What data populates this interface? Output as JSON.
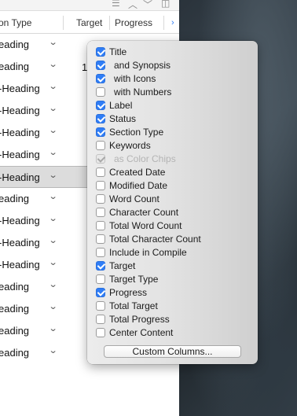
{
  "header": {
    "col_section_type": "on Type",
    "col_target": "Target",
    "col_progress": "Progress",
    "target_first_value_partial": "1"
  },
  "rows": [
    {
      "label": "eading"
    },
    {
      "label": "eading"
    },
    {
      "label": "-Heading"
    },
    {
      "label": "-Heading"
    },
    {
      "label": "-Heading"
    },
    {
      "label": "-Heading"
    },
    {
      "label": "-Heading"
    },
    {
      "label": "eading"
    },
    {
      "label": "-Heading"
    },
    {
      "label": "-Heading"
    },
    {
      "label": "-Heading"
    },
    {
      "label": "eading"
    },
    {
      "label": "eading"
    },
    {
      "label": "eading"
    },
    {
      "label": "eading"
    }
  ],
  "menu": {
    "items": [
      {
        "label": "Title",
        "checked": true,
        "indent": false,
        "disabled": false
      },
      {
        "label": "and Synopsis",
        "checked": true,
        "indent": true,
        "disabled": false
      },
      {
        "label": "with Icons",
        "checked": true,
        "indent": true,
        "disabled": false
      },
      {
        "label": "with Numbers",
        "checked": false,
        "indent": true,
        "disabled": false
      },
      {
        "label": "Label",
        "checked": true,
        "indent": false,
        "disabled": false
      },
      {
        "label": "Status",
        "checked": true,
        "indent": false,
        "disabled": false
      },
      {
        "label": "Section Type",
        "checked": true,
        "indent": false,
        "disabled": false
      },
      {
        "label": "Keywords",
        "checked": false,
        "indent": false,
        "disabled": false
      },
      {
        "label": "as Color Chips",
        "checked": true,
        "indent": true,
        "disabled": true
      },
      {
        "label": "Created Date",
        "checked": false,
        "indent": false,
        "disabled": false
      },
      {
        "label": "Modified Date",
        "checked": false,
        "indent": false,
        "disabled": false
      },
      {
        "label": "Word Count",
        "checked": false,
        "indent": false,
        "disabled": false
      },
      {
        "label": "Character Count",
        "checked": false,
        "indent": false,
        "disabled": false
      },
      {
        "label": "Total Word Count",
        "checked": false,
        "indent": false,
        "disabled": false
      },
      {
        "label": "Total Character Count",
        "checked": false,
        "indent": false,
        "disabled": false
      },
      {
        "label": "Include in Compile",
        "checked": false,
        "indent": false,
        "disabled": false
      },
      {
        "label": "Target",
        "checked": true,
        "indent": false,
        "disabled": false
      },
      {
        "label": "Target Type",
        "checked": false,
        "indent": false,
        "disabled": false
      },
      {
        "label": "Progress",
        "checked": true,
        "indent": false,
        "disabled": false
      },
      {
        "label": "Total Target",
        "checked": false,
        "indent": false,
        "disabled": false
      },
      {
        "label": "Total Progress",
        "checked": false,
        "indent": false,
        "disabled": false
      },
      {
        "label": "Center Content",
        "checked": false,
        "indent": false,
        "disabled": false
      }
    ],
    "custom_columns_label": "Custom Columns..."
  },
  "icons": {
    "toolbar": [
      "list-icon",
      "chevron-up-icon",
      "chevron-down-icon",
      "split-view-icon"
    ],
    "row_disclosure": "chevron-down-icon",
    "column_overflow": "chevron-right-icon"
  },
  "colors": {
    "accent": "#2f7df6",
    "selected_row": "#dcdcdc"
  }
}
